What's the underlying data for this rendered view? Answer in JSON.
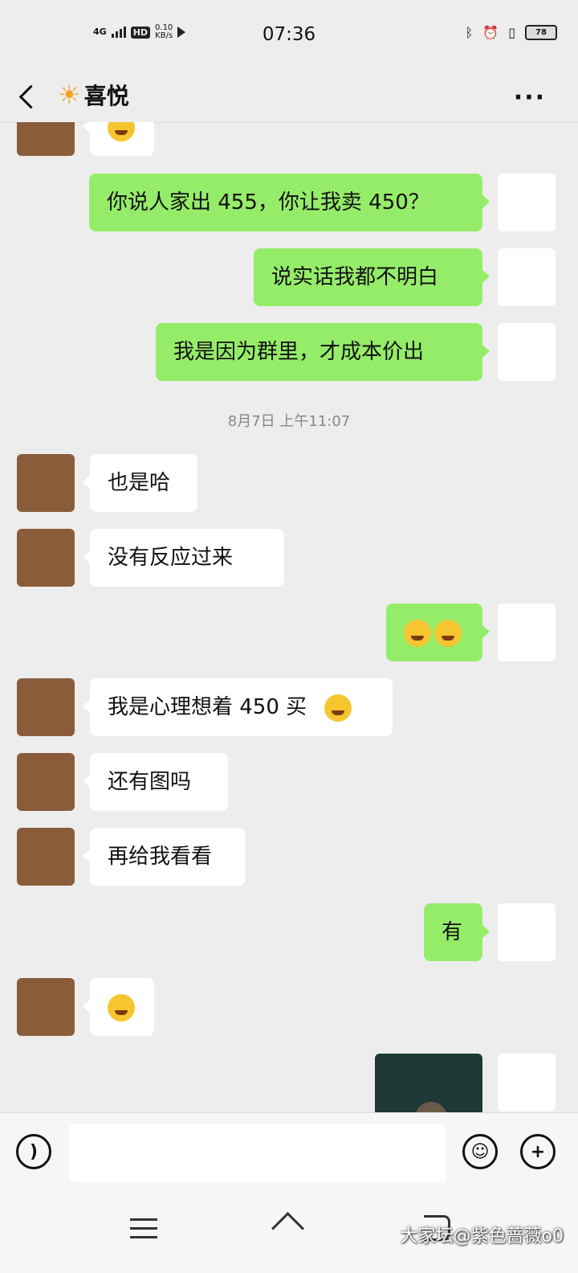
{
  "status_bar": {
    "network": "4G",
    "hd": "HD",
    "speed_value": "0.10",
    "speed_unit": "KB/s",
    "time": "07:36",
    "battery": "78"
  },
  "header": {
    "title": "喜悦"
  },
  "messages": [
    {
      "text": "你说人家出 455，你让我卖 450？"
    },
    {
      "text": "说实话我都不明白"
    },
    {
      "text": "我是因为群里，才成本价出"
    },
    {
      "text": "也是哈"
    },
    {
      "text": "没有反应过来"
    },
    {
      "text": "我是心理想着 450 买"
    },
    {
      "text": "还有图吗"
    },
    {
      "text": "再给我看看"
    },
    {
      "text": "有"
    }
  ],
  "timestamp": "8月7日 上午11:07",
  "input": {
    "placeholder": ""
  },
  "watermark": "大家坛@紫色蔷薇o0",
  "colors": {
    "outgoing_bubble": "#95ec69",
    "incoming_bubble": "#ffffff",
    "background": "#ededed"
  }
}
